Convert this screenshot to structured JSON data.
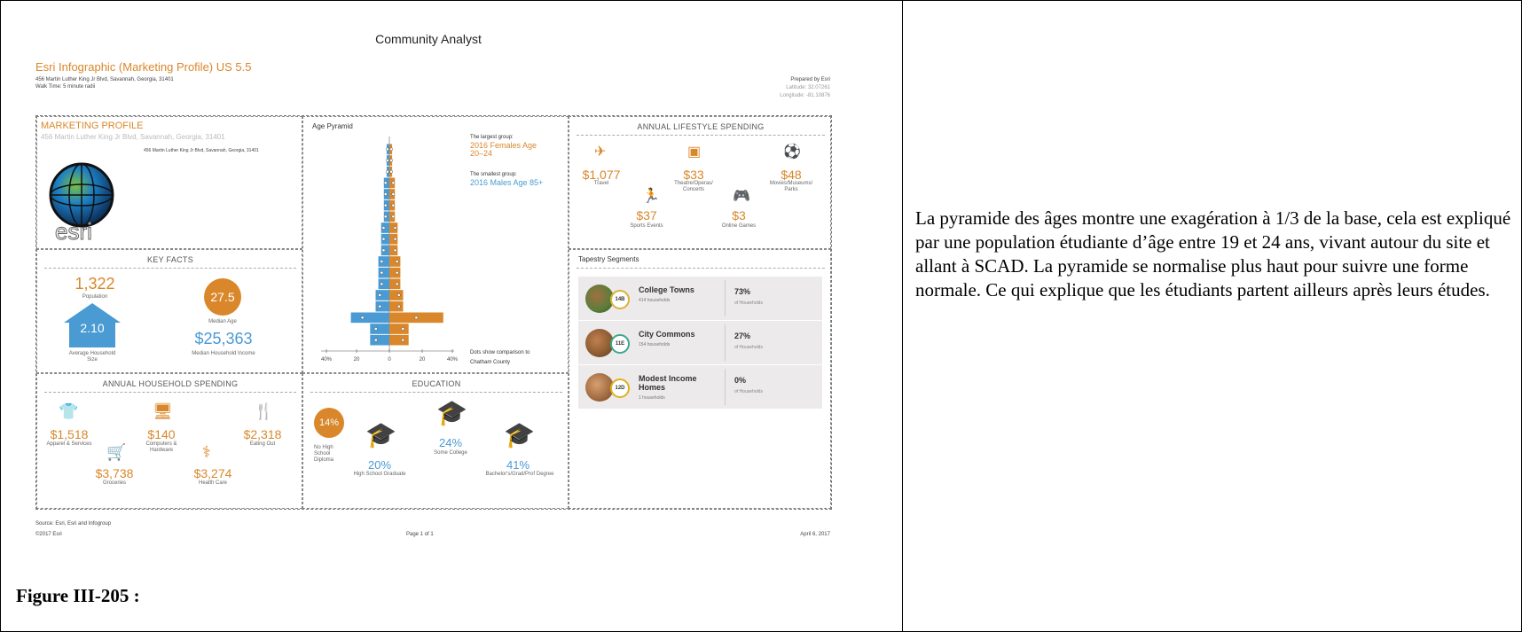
{
  "report": {
    "title": "Community Analyst",
    "subtitle": "Esri Infographic (Marketing Profile) US 5.5",
    "address": "456 Martin Luther King Jr Blvd, Savannah, Georgia, 31401",
    "walk_time": "Walk Time: 5 minute radii",
    "prepared_by": "Prepared by Esri",
    "latitude": "Latitude: 32.07261",
    "longitude": "Longitude: -81.10876"
  },
  "marketing_profile": {
    "title": "MARKETING PROFILE",
    "address": "456 Martin Luther King Jr Blvd, Savannah, Georgia, 31401",
    "address_small": "456 Martin Luther King Jr Blvd, Savannah, Georgia, 31401",
    "logo_text": "esri"
  },
  "age_pyramid": {
    "title": "Age Pyramid",
    "largest_label": "The largest group:",
    "largest_value": "2016 Females Age 20–24",
    "smallest_label": "The smallest group:",
    "smallest_value": "2016 Males Age 85+",
    "note": "Dots show comparison to Chatham County",
    "axis_ticks": [
      "40%",
      "20",
      "0",
      "20",
      "40%"
    ],
    "male_color": "#4a9ad3",
    "female_color": "#d9872a"
  },
  "lifestyle": {
    "title": "ANNUAL LIFESTYLE SPENDING",
    "items": [
      {
        "value": "$1,077",
        "label": "Travel",
        "icon": "airplane-icon"
      },
      {
        "value": "$33",
        "label": "Theatre/Operas/ Concerts",
        "icon": "ticket-icon"
      },
      {
        "value": "$48",
        "label": "Movies/Museums/ Parks",
        "icon": "soccer-ball-icon"
      },
      {
        "value": "$37",
        "label": "Sports Events",
        "icon": "athlete-icon"
      },
      {
        "value": "$3",
        "label": "Online Games",
        "icon": "gamepad-icon"
      }
    ]
  },
  "key_facts": {
    "title": "KEY FACTS",
    "population_value": "1,322",
    "population_label": "Population",
    "median_age_value": "27.5",
    "median_age_label": "Median Age",
    "household_size_value": "2.10",
    "household_size_label": "Average Household Size",
    "income_value": "$25,363",
    "income_label": "Median Household Income"
  },
  "tapestry": {
    "title": "Tapestry Segments",
    "segments": [
      {
        "code": "14B",
        "name": "College Towns",
        "households": "414 households",
        "pct": "73%",
        "of": "of Households"
      },
      {
        "code": "11E",
        "name": "City Commons",
        "households": "154 households",
        "pct": "27%",
        "of": "of Households"
      },
      {
        "code": "12D",
        "name": "Modest Income Homes",
        "households": "1 households",
        "pct": "0%",
        "of": "of Households"
      }
    ]
  },
  "household_spending": {
    "title": "ANNUAL HOUSEHOLD SPENDING",
    "items": [
      {
        "value": "$1,518",
        "label": "Apparel & Services",
        "icon": "shirt-icon"
      },
      {
        "value": "$140",
        "label": "Computers & Hardware",
        "icon": "monitor-icon"
      },
      {
        "value": "$2,318",
        "label": "Eating Out",
        "icon": "fork-knife-icon"
      },
      {
        "value": "$3,738",
        "label": "Groceries",
        "icon": "cart-icon"
      },
      {
        "value": "$3,274",
        "label": "Health Care",
        "icon": "stethoscope-icon"
      }
    ]
  },
  "education": {
    "title": "EDUCATION",
    "no_hs_value": "14%",
    "no_hs_label": "No High School Diploma",
    "hs_value": "20%",
    "hs_label": "High School Graduate",
    "some_college_value": "24%",
    "some_college_label": "Some College",
    "bachelors_value": "41%",
    "bachelors_label": "Bachelor's/Grad/Prof Degree"
  },
  "footer": {
    "source": "Source: Esri, Esri and Infogroup",
    "copyright": "©2017 Esri",
    "page": "Page 1 of 1",
    "date": "April 6, 2017"
  },
  "caption": "Figure III-205 :",
  "commentary": "La pyramide des âges montre une exagération à 1/3 de la base, cela est expliqué par une population étudiante d’âge entre 19 et 24 ans, vivant autour du site et allant à SCAD. La pyramide se normalise plus haut pour suivre une forme normale. Ce qui explique que les étudiants partent ailleurs après leurs études."
}
